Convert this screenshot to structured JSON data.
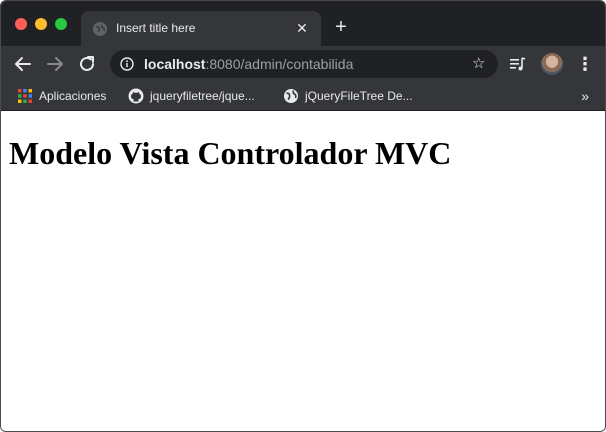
{
  "browser": {
    "tab": {
      "title": "Insert title here",
      "favicon": "globe-icon"
    },
    "address_bar": {
      "host": "localhost",
      "rest": ":8080/admin/contabilida"
    },
    "bookmarks": [
      {
        "label": "Aplicaciones",
        "icon": "apps-grid-icon"
      },
      {
        "label": "jqueryfiletree/jque...",
        "icon": "github-icon"
      },
      {
        "label": "jQueryFileTree De...",
        "icon": "globe-icon"
      }
    ],
    "bookmarks_overflow": "»",
    "colors": {
      "frame": "#202124",
      "toolbar": "#35363a",
      "text": "#e8eaed"
    }
  },
  "page": {
    "heading": "Modelo Vista Controlador MVC"
  }
}
